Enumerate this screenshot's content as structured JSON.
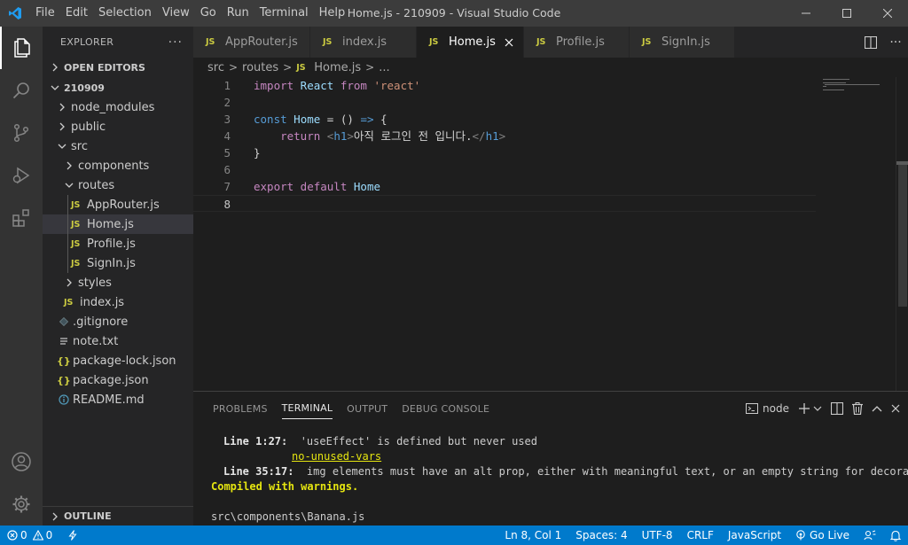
{
  "window": {
    "title": "Home.js - 210909 - Visual Studio Code",
    "menu": [
      "File",
      "Edit",
      "Selection",
      "View",
      "Go",
      "Run",
      "Terminal",
      "Help"
    ]
  },
  "sidebar": {
    "title": "EXPLORER",
    "open_editors": "OPEN EDITORS",
    "folder": "210909",
    "tree": [
      {
        "label": "node_modules",
        "kind": "folder"
      },
      {
        "label": "public",
        "kind": "folder"
      },
      {
        "label": "src",
        "kind": "folder-open"
      },
      {
        "label": "components",
        "kind": "folder"
      },
      {
        "label": "routes",
        "kind": "folder-open"
      },
      {
        "label": "AppRouter.js",
        "kind": "js"
      },
      {
        "label": "Home.js",
        "kind": "js",
        "selected": true
      },
      {
        "label": "Profile.js",
        "kind": "js"
      },
      {
        "label": "SignIn.js",
        "kind": "js"
      },
      {
        "label": "styles",
        "kind": "folder"
      },
      {
        "label": "index.js",
        "kind": "js"
      },
      {
        "label": ".gitignore",
        "kind": "git"
      },
      {
        "label": "note.txt",
        "kind": "txt"
      },
      {
        "label": "package-lock.json",
        "kind": "json"
      },
      {
        "label": "package.json",
        "kind": "json"
      },
      {
        "label": "README.md",
        "kind": "info"
      }
    ],
    "outline": "OUTLINE"
  },
  "tabs": [
    {
      "label": "AppRouter.js",
      "badge": "JS"
    },
    {
      "label": "index.js",
      "badge": "JS"
    },
    {
      "label": "Home.js",
      "badge": "JS",
      "active": true
    },
    {
      "label": "Profile.js",
      "badge": "JS"
    },
    {
      "label": "SignIn.js",
      "badge": "JS"
    }
  ],
  "breadcrumb": {
    "src": "src",
    "routes": "routes",
    "file_badge": "JS",
    "file": "Home.js",
    "more": "..."
  },
  "editor": {
    "lines": [
      {
        "num": "1",
        "tokens": [
          [
            "kw",
            "import"
          ],
          [
            "",
            ""
          ],
          [
            "var",
            " React"
          ],
          [
            "kw",
            " from"
          ],
          [
            "str",
            " 'react'"
          ]
        ]
      },
      {
        "num": "2",
        "tokens": []
      },
      {
        "num": "3",
        "tokens": [
          [
            "kwb",
            "const"
          ],
          [
            "var",
            " Home"
          ],
          [
            "",
            " = () "
          ],
          [
            "kwb",
            "=>"
          ],
          [
            "",
            " {"
          ]
        ]
      },
      {
        "num": "4",
        "tokens": [
          [
            "kw",
            "    return"
          ],
          [
            "tagc",
            " <"
          ],
          [
            "kwb",
            "h1"
          ],
          [
            "tagc",
            ">"
          ],
          [
            "",
            "아직 로그인 전 입니다."
          ],
          [
            "tagc",
            "</"
          ],
          [
            "kwb",
            "h1"
          ],
          [
            "tagc",
            ">"
          ]
        ]
      },
      {
        "num": "5",
        "tokens": [
          [
            "",
            "}"
          ]
        ]
      },
      {
        "num": "6",
        "tokens": []
      },
      {
        "num": "7",
        "tokens": [
          [
            "kw",
            "export"
          ],
          [
            "kw",
            " default"
          ],
          [
            "var",
            " Home"
          ]
        ]
      },
      {
        "num": "8",
        "tokens": [],
        "current": true
      }
    ]
  },
  "panel": {
    "tabs": [
      "PROBLEMS",
      "TERMINAL",
      "OUTPUT",
      "DEBUG CONSOLE"
    ],
    "active_tab": "TERMINAL",
    "terminal_name": "node",
    "terminal": {
      "l1_pos": "Line 1:27:",
      "l1_msg": "  'useEffect' is defined but never used",
      "l2_rule": "no-unused-vars",
      "l3_pos": "Line 35:17:",
      "l3_msg": "  img elements must have an alt prop, either with meaningful text, or an empty string for decora",
      "l4": "Compiled with warnings.",
      "l5": "src\\components\\Banana.js"
    }
  },
  "statusbar": {
    "errors": "0",
    "warnings": "0",
    "position": "Ln 8, Col 1",
    "spaces": "Spaces: 4",
    "encoding": "UTF-8",
    "eol": "CRLF",
    "language": "JavaScript",
    "golive": "Go Live"
  },
  "colors": {
    "accent": "#007acc",
    "titlebar": "#3c3c3c",
    "sidebar": "#252526",
    "editor": "#1e1e1e",
    "js_badge": "#cbcb41"
  }
}
